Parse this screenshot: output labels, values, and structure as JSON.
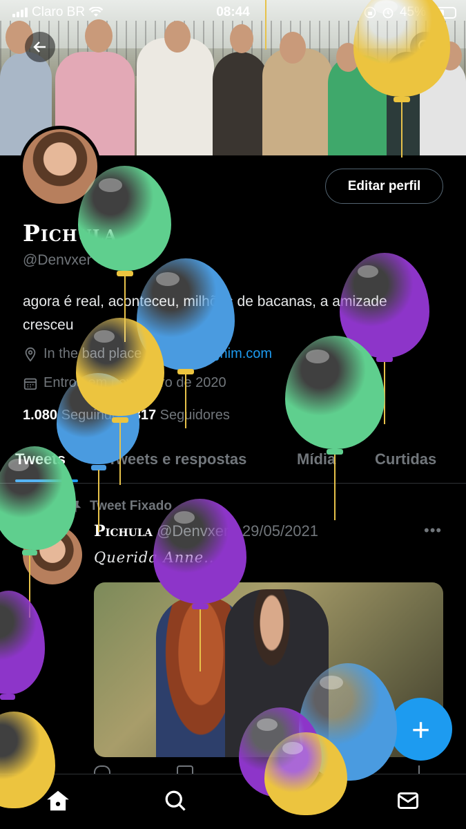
{
  "status_bar": {
    "carrier": "Claro BR",
    "time": "08:44",
    "battery": "45%"
  },
  "profile": {
    "display_name": "Pichula",
    "handle": "@Denvxer",
    "edit_button": "Editar perfil",
    "bio": "agora é real, aconteceu, milhões de bacanas, a amizade cresceu",
    "location": "In the bad place",
    "website": "meneghim.com",
    "joined": "Entrou em novembro de 2020",
    "following_count": "1.080",
    "following_label": "Seguindo",
    "followers_count": "817",
    "followers_label": "Seguidores"
  },
  "tabs": [
    {
      "label": "Tweets",
      "active": true
    },
    {
      "label": "Tweets e respostas",
      "active": false
    },
    {
      "label": "Mídia",
      "active": false
    },
    {
      "label": "Curtidas",
      "active": false
    }
  ],
  "pinned_tweet": {
    "pin_label": "Tweet Fixado",
    "author_name": "Pichula",
    "author_handle": "@Denvxer",
    "separator": "·",
    "date": "29/05/2021",
    "more": "•••",
    "text": "Querida Anne..."
  },
  "fab": {
    "label": "+"
  },
  "bottom_nav": [
    "home-icon",
    "search-icon",
    "bell-icon",
    "mail-icon"
  ],
  "balloon_colors": {
    "green": "#5fcf8e",
    "blue": "#4a9be0",
    "yellow": "#ecc43f",
    "purple": "#8d35c9"
  },
  "accent": "#1d9bf0"
}
